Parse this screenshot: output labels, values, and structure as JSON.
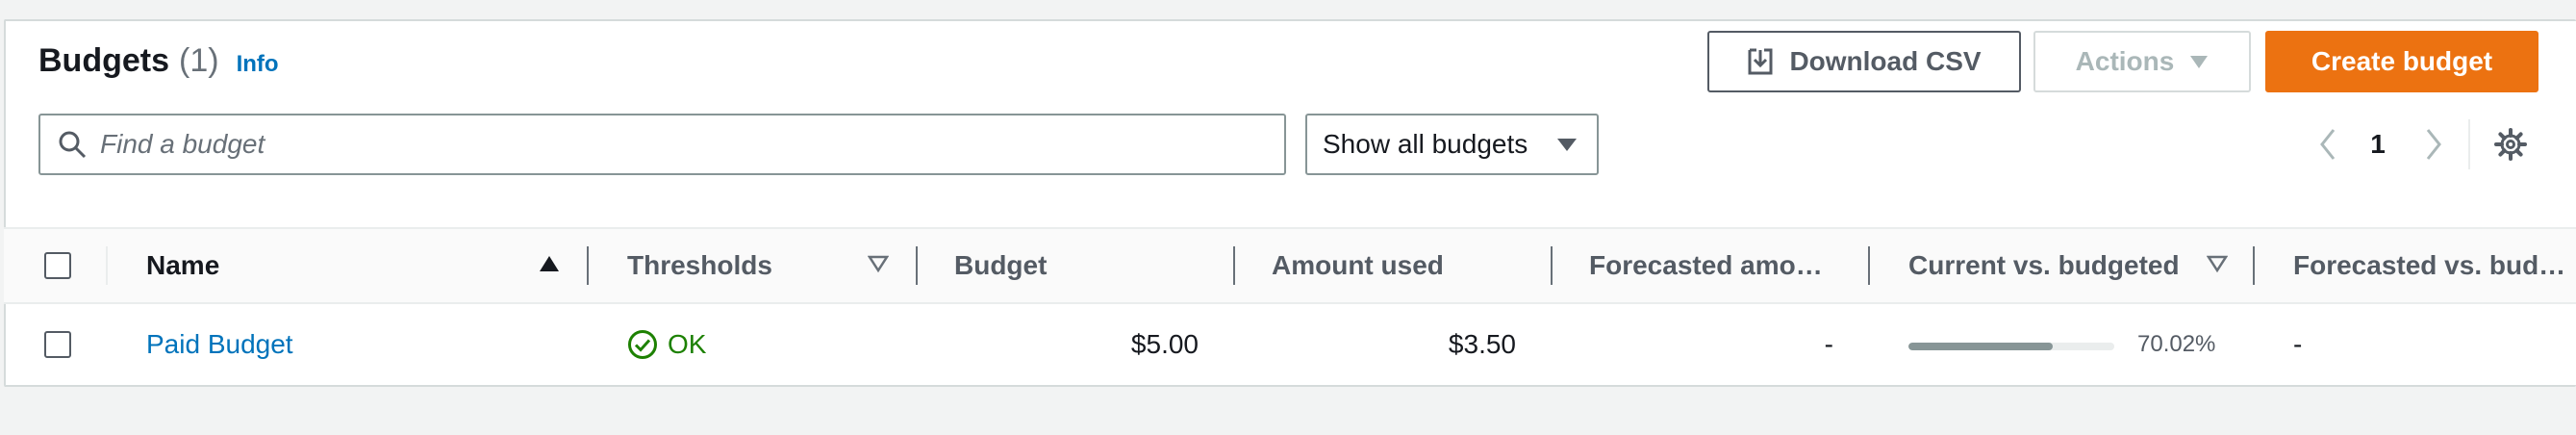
{
  "header": {
    "title": "Budgets",
    "count": "(1)",
    "info": "Info"
  },
  "buttons": {
    "download_csv": "Download CSV",
    "actions": "Actions",
    "create_budget": "Create budget"
  },
  "filter": {
    "search_placeholder": "Find a budget",
    "select_value": "Show all budgets"
  },
  "pagination": {
    "current_page": "1"
  },
  "table": {
    "columns": [
      "Name",
      "Thresholds",
      "Budget",
      "Amount used",
      "Forecasted amo…",
      "Current vs. budgeted",
      "Forecasted vs. bud…"
    ],
    "rows": [
      {
        "name": "Paid Budget",
        "thresholds": "OK",
        "budget": "$5.00",
        "amount_used": "$3.50",
        "forecasted_amount": "-",
        "current_vs_budgeted_pct": "70.02%",
        "current_vs_budgeted_fraction": 0.7002,
        "forecasted_vs_budgeted": "-"
      }
    ]
  },
  "colors": {
    "primary": "#ec7211",
    "link": "#0073bb",
    "ok": "#1d8102"
  }
}
